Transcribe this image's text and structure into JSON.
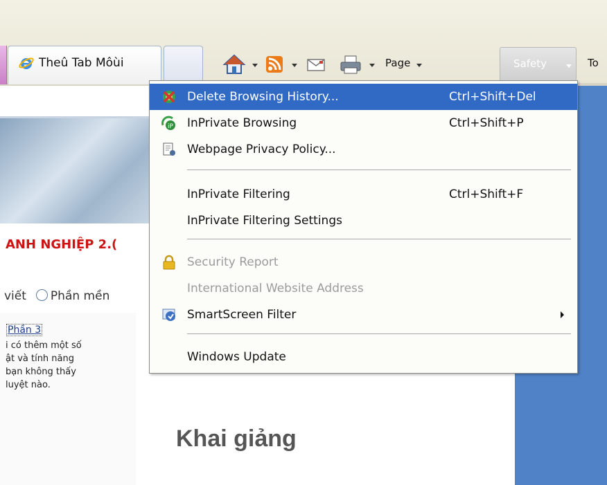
{
  "toolbar": {
    "tab_label": "Theû Tab Môùi",
    "page_label": "Page",
    "safety_label": "Safety",
    "tools_label_partial": "To",
    "icons": [
      "home-icon",
      "rss-feed-icon",
      "mail-icon",
      "print-icon"
    ]
  },
  "page": {
    "heading": "ANH NGHIỆP 2.(",
    "radio_text_left": "viết",
    "radio_text_right": "Phần mền",
    "article_link": "Phần 3",
    "excerpt_lines": [
      "i có thêm một số",
      "ật và tính năng",
      "bạn không thấy",
      "luyệt nào."
    ],
    "khai_giang": "Khai giảng"
  },
  "menu": {
    "items": [
      {
        "label": "Delete Browsing History...",
        "shortcut": "Ctrl+Shift+Del",
        "icon": "delete-history-icon",
        "highlighted": true
      },
      {
        "label": "InPrivate Browsing",
        "shortcut": "Ctrl+Shift+P",
        "icon": "inprivate-icon"
      },
      {
        "label": "Webpage Privacy Policy...",
        "shortcut": "",
        "icon": "privacy-policy-icon"
      },
      {
        "label": "InPrivate Filtering",
        "shortcut": "Ctrl+Shift+F",
        "icon": ""
      },
      {
        "label": "InPrivate Filtering Settings",
        "shortcut": "",
        "icon": ""
      },
      {
        "label": "Security Report",
        "shortcut": "",
        "icon": "lock-icon",
        "disabled": true
      },
      {
        "label": "International Website Address",
        "shortcut": "",
        "icon": "",
        "disabled": true
      },
      {
        "label": "SmartScreen Filter",
        "shortcut": "",
        "icon": "smartscreen-icon",
        "submenu": true
      },
      {
        "label": "Windows Update",
        "shortcut": "",
        "icon": ""
      }
    ]
  },
  "colors": {
    "highlight": "#316ac5",
    "heading_red": "#cc1414",
    "side_blue": "#4f82c7"
  }
}
